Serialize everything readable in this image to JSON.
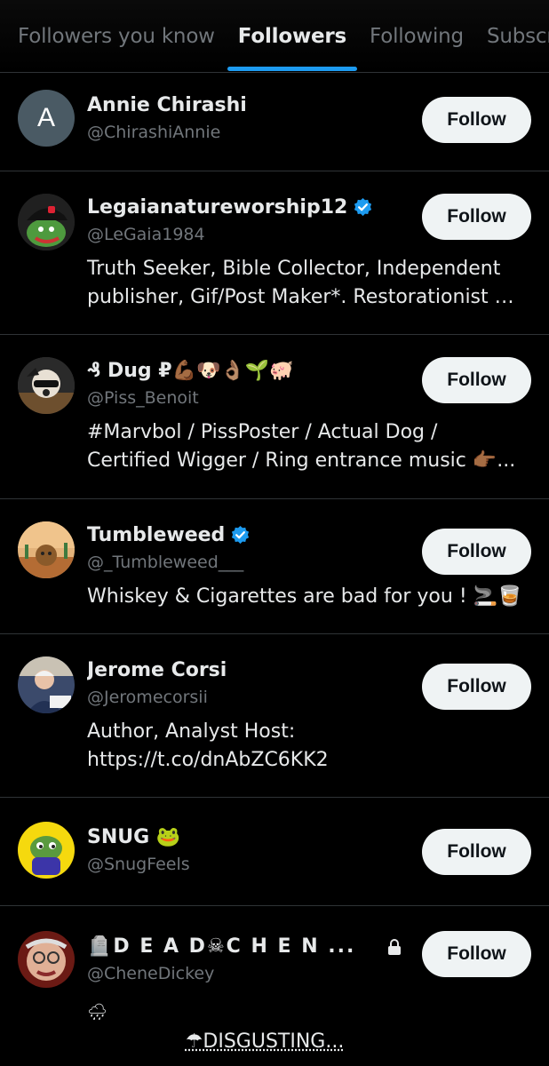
{
  "tabs": [
    {
      "label": "Followers you know",
      "active": false
    },
    {
      "label": "Followers",
      "active": true
    },
    {
      "label": "Following",
      "active": false
    },
    {
      "label": "Subscri",
      "active": false
    }
  ],
  "follow_label": "Follow",
  "colors": {
    "accent": "#1d9bf0",
    "muted": "#71767b",
    "divider": "#2f3336",
    "button_bg": "#eff3f4"
  },
  "users": [
    {
      "avatar_initial": "A",
      "name": "Annie Chirashi",
      "handle": "@ChirashiAnnie",
      "verified": false,
      "bio": []
    },
    {
      "name": "Legaianatureworship12",
      "handle": "@LeGaia1984",
      "verified": true,
      "bio": [
        "Truth Seeker, Bible Collector, Independent",
        "publisher, Gif/Post Maker*. Restorationist M..."
      ]
    },
    {
      "name": "₰ Dug ₽💪🏾🐶👌🏽🌱🐖",
      "handle": "@Piss_Benoit",
      "verified": false,
      "bio": [
        "#Marvbol / PissPoster / Actual Dog /",
        "Certified Wigger / Ring entrance music 👉🏾..."
      ]
    },
    {
      "name": "Tumbleweed",
      "handle": "@_Tumbleweed___",
      "verified": true,
      "bio": [
        "Whiskey & Cigarettes are bad for you ! 🚬🥃"
      ]
    },
    {
      "name": "Jerome Corsi",
      "handle": "@Jeromecorsii",
      "verified": false,
      "bio": [
        "Author, Analyst Host:",
        "https://t.co/dnAbZC6KK2"
      ]
    },
    {
      "name": "SNUG 🐸",
      "handle": "@SnugFeels",
      "verified": false,
      "bio": []
    },
    {
      "name": "🪦D E A D☠C H E N ...",
      "handle": "@CheneDickey",
      "verified": false,
      "locked": true,
      "bio": [
        "🌧"
      ],
      "bio_line2": "☂DISGUSTING..."
    }
  ]
}
